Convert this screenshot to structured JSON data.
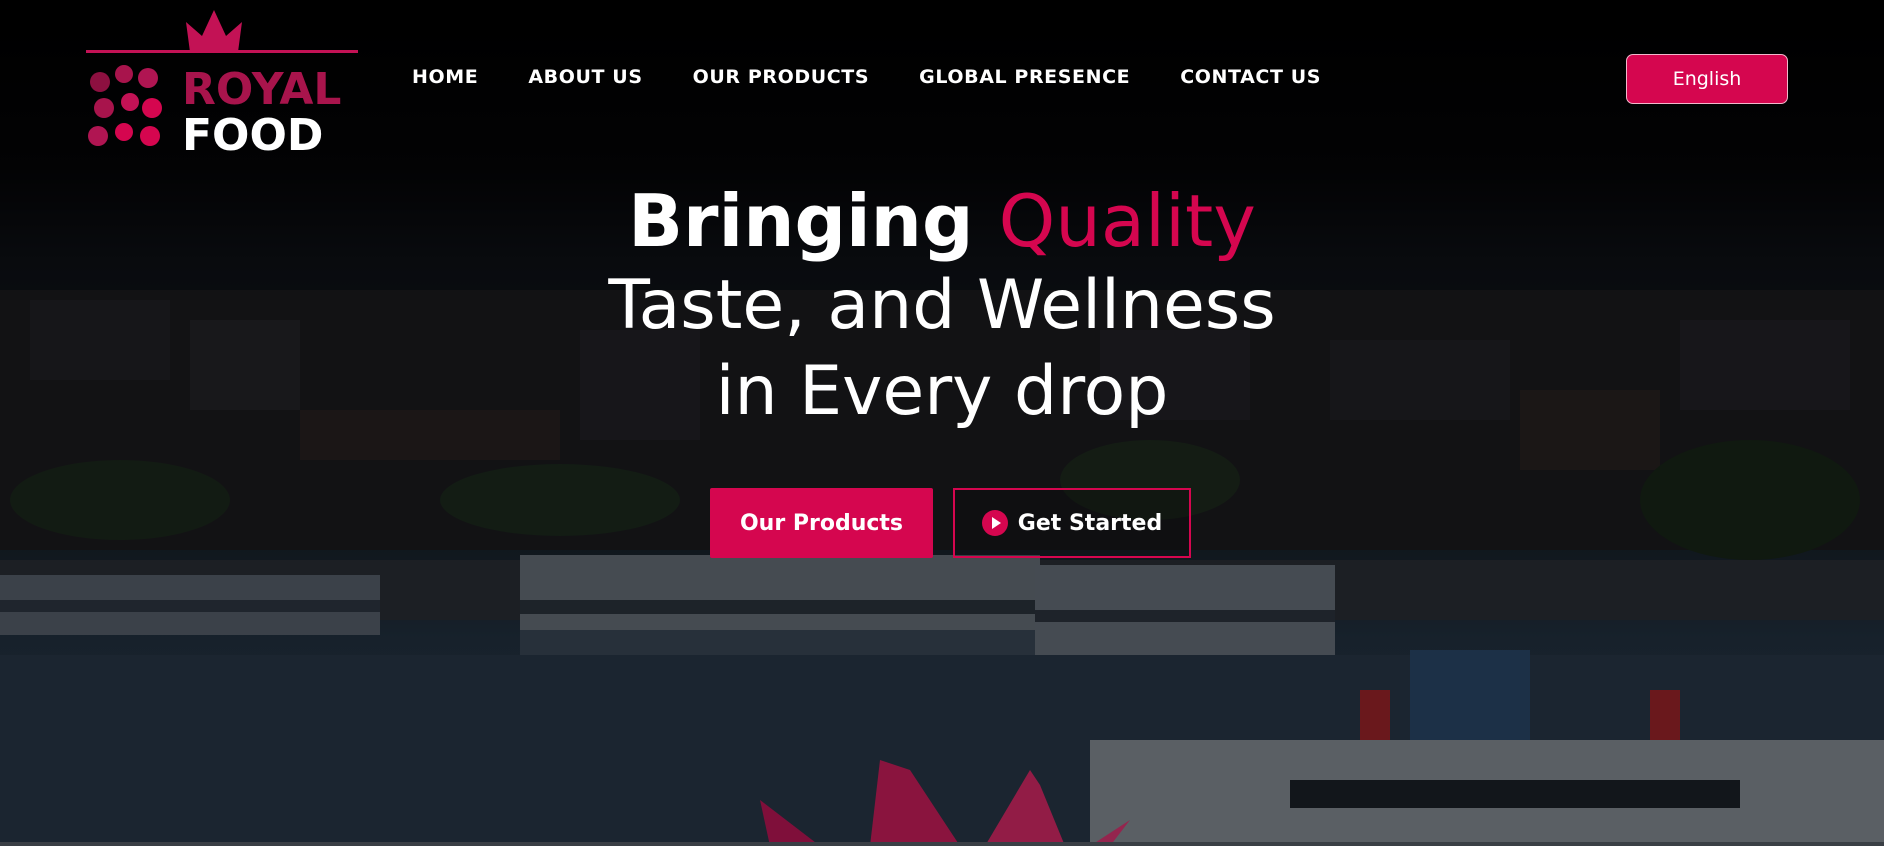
{
  "brand": {
    "line1": "ROYAL",
    "line2": "FOOD"
  },
  "nav": {
    "items": [
      {
        "label": "HOME"
      },
      {
        "label": "ABOUT US"
      },
      {
        "label": "OUR PRODUCTS"
      },
      {
        "label": "GLOBAL PRESENCE"
      },
      {
        "label": "CONTACT US"
      }
    ]
  },
  "language": {
    "label": "English"
  },
  "hero": {
    "title_part1": "Bringing",
    "title_accent": "Quality",
    "line2": "Taste, and Wellness",
    "line3": "in Every drop",
    "primary_cta": "Our Products",
    "secondary_cta": "Get Started"
  },
  "colors": {
    "accent": "#d5064f",
    "background": "#000000",
    "text": "#ffffff"
  },
  "icons": {
    "cta_secondary": "play-circle-icon",
    "logo": "crown-icon"
  }
}
